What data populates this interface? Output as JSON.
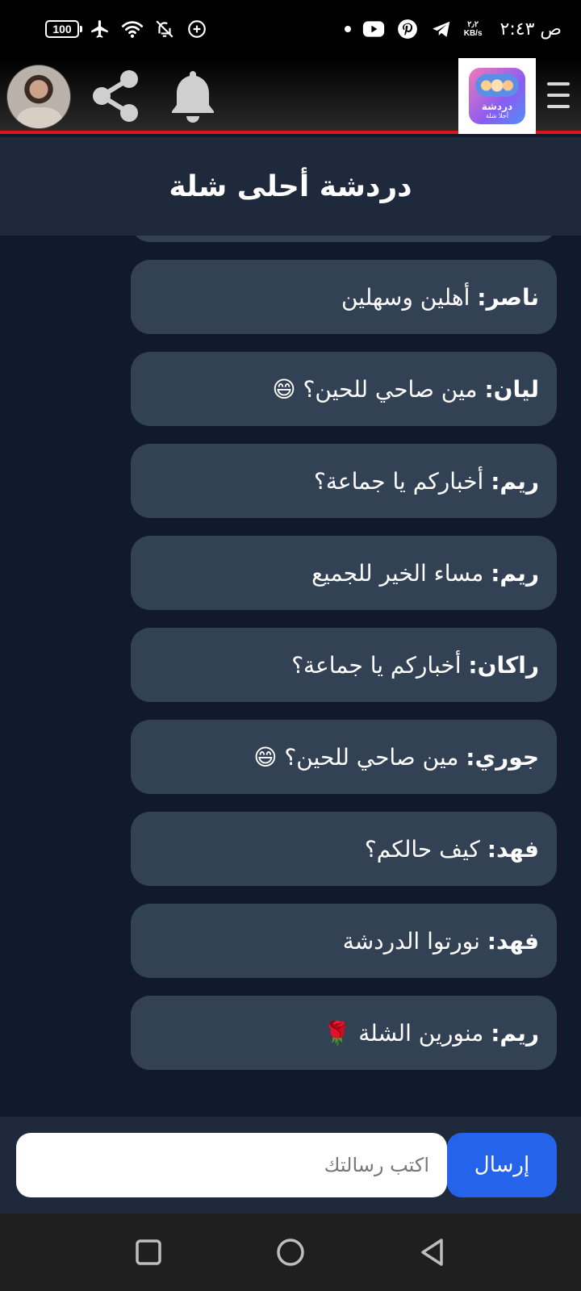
{
  "status_bar": {
    "battery": "100",
    "speed_value": "٢٫٢",
    "speed_unit": "KB/s",
    "time": "ص ٢:٤٣",
    "icons": [
      "airplane-icon",
      "wifi-icon",
      "bell-off-icon",
      "data-saver-icon",
      "youtube-icon",
      "pinterest-icon",
      "telegram-icon"
    ]
  },
  "header": {
    "logo_line1": "دردشة",
    "logo_line2": "أحلا شلة",
    "icons": [
      "avatar",
      "share-icon",
      "bell-icon",
      "menu-icon"
    ]
  },
  "chat": {
    "title": "دردشة أحلى شلة",
    "messages": [
      {
        "sender": "ناصر:",
        "text": "أهلين وسهلين"
      },
      {
        "sender": "ليان:",
        "text": "مين صاحي للحين؟ 😄"
      },
      {
        "sender": "ريم:",
        "text": "أخباركم يا جماعة؟"
      },
      {
        "sender": "ريم:",
        "text": "مساء الخير للجميع"
      },
      {
        "sender": "راكان:",
        "text": "أخباركم يا جماعة؟"
      },
      {
        "sender": "جوري:",
        "text": "مين صاحي للحين؟ 😄"
      },
      {
        "sender": "فهد:",
        "text": "كيف حالكم؟"
      },
      {
        "sender": "فهد:",
        "text": "نورتوا الدردشة"
      },
      {
        "sender": "ريم:",
        "text": "منورين الشلة 🌹"
      }
    ]
  },
  "composer": {
    "placeholder": "اكتب رسالتك",
    "value": "",
    "send_label": "إرسال"
  },
  "colors": {
    "background": "#111a2d",
    "panel": "#1e293b",
    "bubble": "#334155",
    "accent": "#2563eb",
    "header_border": "#d9151b"
  },
  "nav": {
    "icons": [
      "recents-icon",
      "home-icon",
      "back-icon"
    ]
  }
}
